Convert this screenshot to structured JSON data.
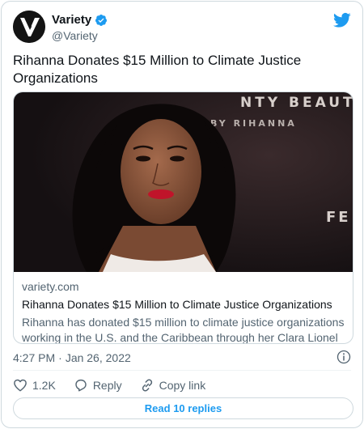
{
  "account": {
    "display_name": "Variety",
    "handle": "@Variety",
    "verified": true,
    "avatar_letter": "V"
  },
  "tweet": {
    "text": "Rihanna Donates $15 Million to Climate Justice Organizations"
  },
  "card": {
    "image_banner_line1": "NTY BEAUTY",
    "image_banner_line2": "BY RIHANNA",
    "image_side_text": "FE",
    "domain": "variety.com",
    "title": "Rihanna Donates $15 Million to Climate Justice Organizations",
    "description": "Rihanna has donated $15 million to climate justice organizations working in the U.S. and the Caribbean through her Clara Lionel ..."
  },
  "meta": {
    "time": "4:27 PM",
    "separator": "·",
    "date": "Jan 26, 2022"
  },
  "actions": {
    "like_count": "1.2K",
    "reply_label": "Reply",
    "copy_link_label": "Copy link"
  },
  "read_replies_label": "Read 10 replies",
  "colors": {
    "accent": "#1d9bf0",
    "heart": "#536471",
    "secondary_text": "#536471",
    "border": "#cfd9de"
  }
}
